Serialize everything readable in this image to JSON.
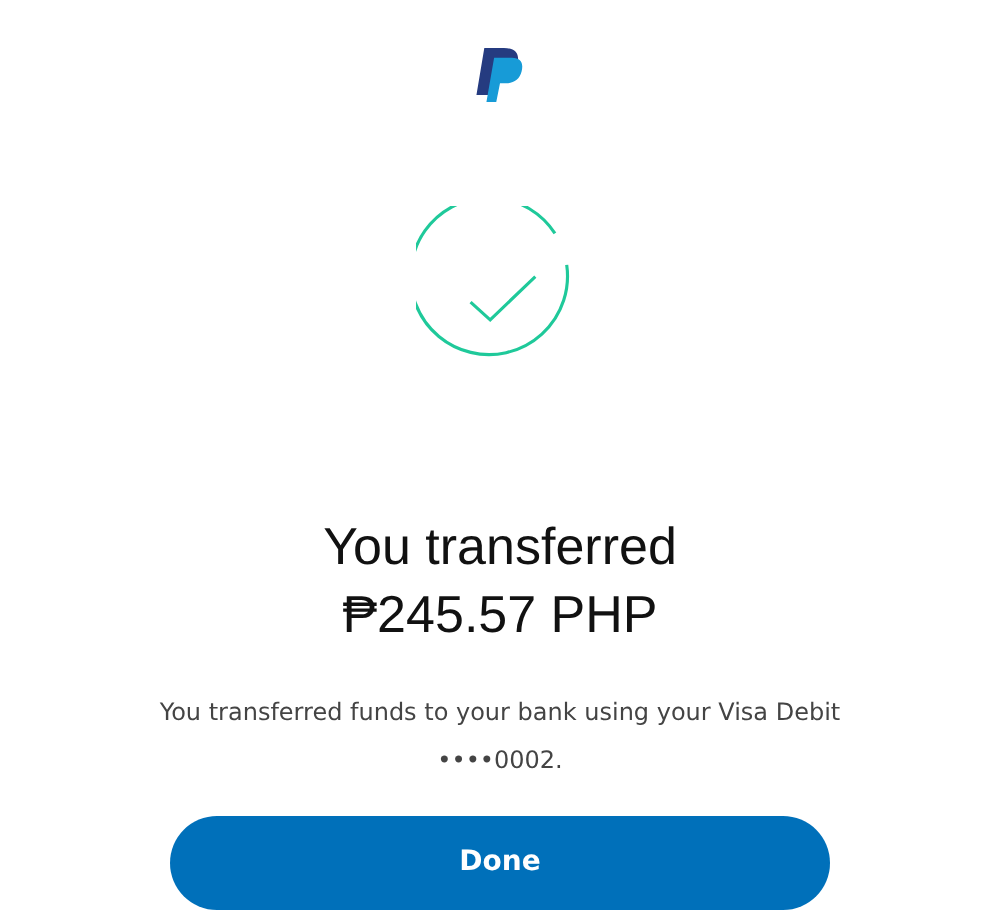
{
  "heading": {
    "title": "You transferred",
    "amount": "₱245.57 PHP"
  },
  "message": {
    "text": "You transferred funds to your bank using your Visa Debit",
    "card": "••••0002."
  },
  "status": {
    "kind": "success"
  },
  "button": {
    "label": "Done"
  }
}
